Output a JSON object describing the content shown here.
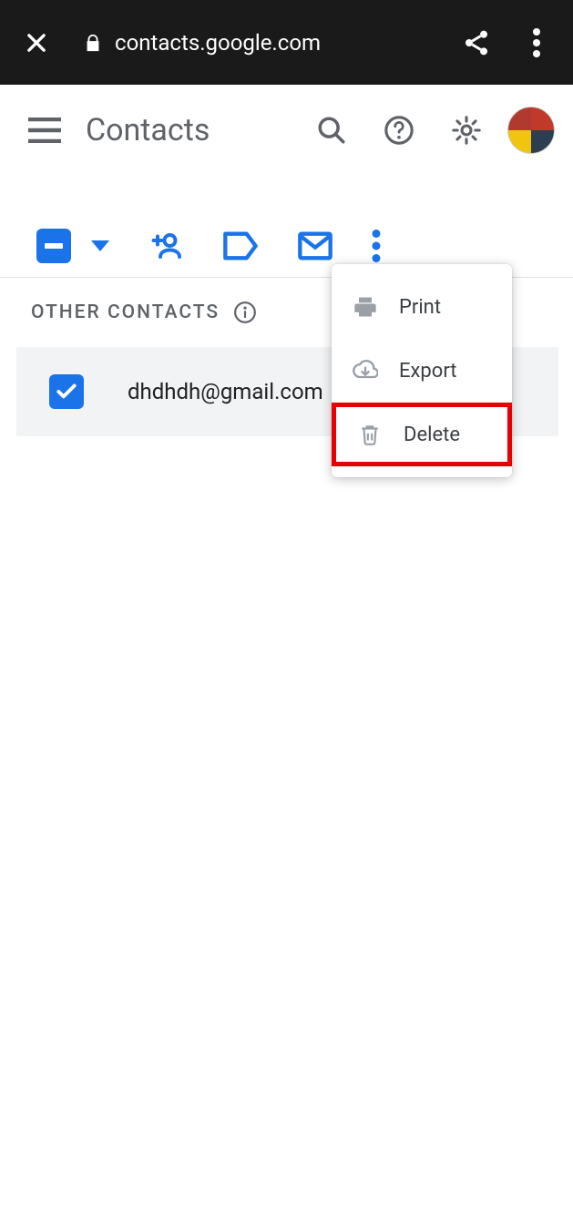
{
  "browser": {
    "url": "contacts.google.com"
  },
  "header": {
    "title": "Contacts"
  },
  "section": {
    "label": "OTHER CONTACTS"
  },
  "contact": {
    "email": "dhdhdh@gmail.com"
  },
  "menu": {
    "print": "Print",
    "export": "Export",
    "delete": "Delete"
  }
}
